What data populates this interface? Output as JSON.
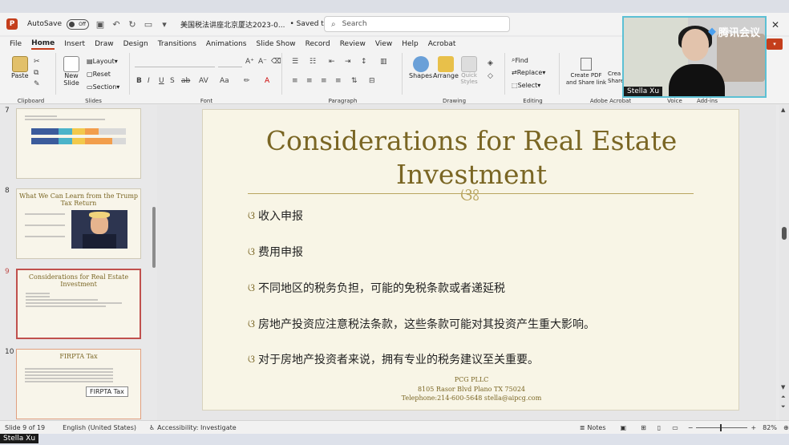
{
  "titlebar": {
    "autosave_label": "AutoSave",
    "autosave_state": "Off",
    "doc_title": "美国税法讲座北京厦达2023-0...",
    "saved_status": "• Saved to this PC ⌄",
    "search_placeholder": "Search",
    "app_letter": "P"
  },
  "menu": {
    "tabs": [
      "File",
      "Home",
      "Insert",
      "Draw",
      "Design",
      "Transitions",
      "Animations",
      "Slide Show",
      "Record",
      "Review",
      "View",
      "Help",
      "Acrobat"
    ],
    "active": "Home"
  },
  "ribbon": {
    "paste": "Paste",
    "clipboard": "Clipboard",
    "new_slide": "New Slide",
    "layout": "Layout",
    "reset": "Reset",
    "section": "Section",
    "slides": "Slides",
    "font": "Font",
    "paragraph": "Paragraph",
    "shapes": "Shapes",
    "arrange": "Arrange",
    "quick_styles": "Quick Styles",
    "drawing": "Drawing",
    "find": "Find",
    "replace": "Replace",
    "select": "Select",
    "editing": "Editing",
    "create_pdf": "Create PDF and Share link",
    "create_share": "Crea Share",
    "adobe": "Adobe Acrobat",
    "voice": "Voice",
    "addins": "Add-ins",
    "font_btns": {
      "bold": "B",
      "italic": "I",
      "underline": "U",
      "strike": "S",
      "ab": "ab",
      "av": "AV",
      "aa": "Aa",
      "font_color": "A"
    }
  },
  "slide_panel": {
    "thumbs": [
      {
        "num": "7",
        "title": ""
      },
      {
        "num": "8",
        "title": "What We Can Learn from the Trump Tax Return"
      },
      {
        "num": "9",
        "title": "Considerations for Real Estate Investment"
      },
      {
        "num": "10",
        "title": "FIRPTA Tax"
      }
    ],
    "tooltip": "FIRPTA Tax"
  },
  "slide": {
    "title": "Considerations for Real Estate Investment",
    "ornament": "ଓଃ",
    "bullet_mark": "ଓ",
    "bullets": [
      "收入申报",
      "费用申报",
      "不同地区的税务负担，可能的免税条款或者递延税",
      "房地产投资应注意税法条款，这些条款可能对其投资产生重大影响。",
      "对于房地产投资者来说，拥有专业的税务建议至关重要。"
    ],
    "footer": {
      "company": "PCG PLLC",
      "address": "8105 Rasor Blvd  Plano TX 75024",
      "contact": "Telephone:214-600-5648    stella@aipcg.com"
    }
  },
  "statusbar": {
    "slide_info": "Slide 9 of 19",
    "language": "English (United States)",
    "accessibility": "Accessibility: Investigate",
    "notes": "Notes",
    "zoom": "82%"
  },
  "video": {
    "meeting_logo": "腾讯会议",
    "speaker": "Stella Xu"
  },
  "bottom_speaker": "Stella Xu",
  "colors": {
    "accent": "#c43e1c",
    "slide_gold": "#7a6624",
    "slide_bg": "#f8f5e6"
  }
}
